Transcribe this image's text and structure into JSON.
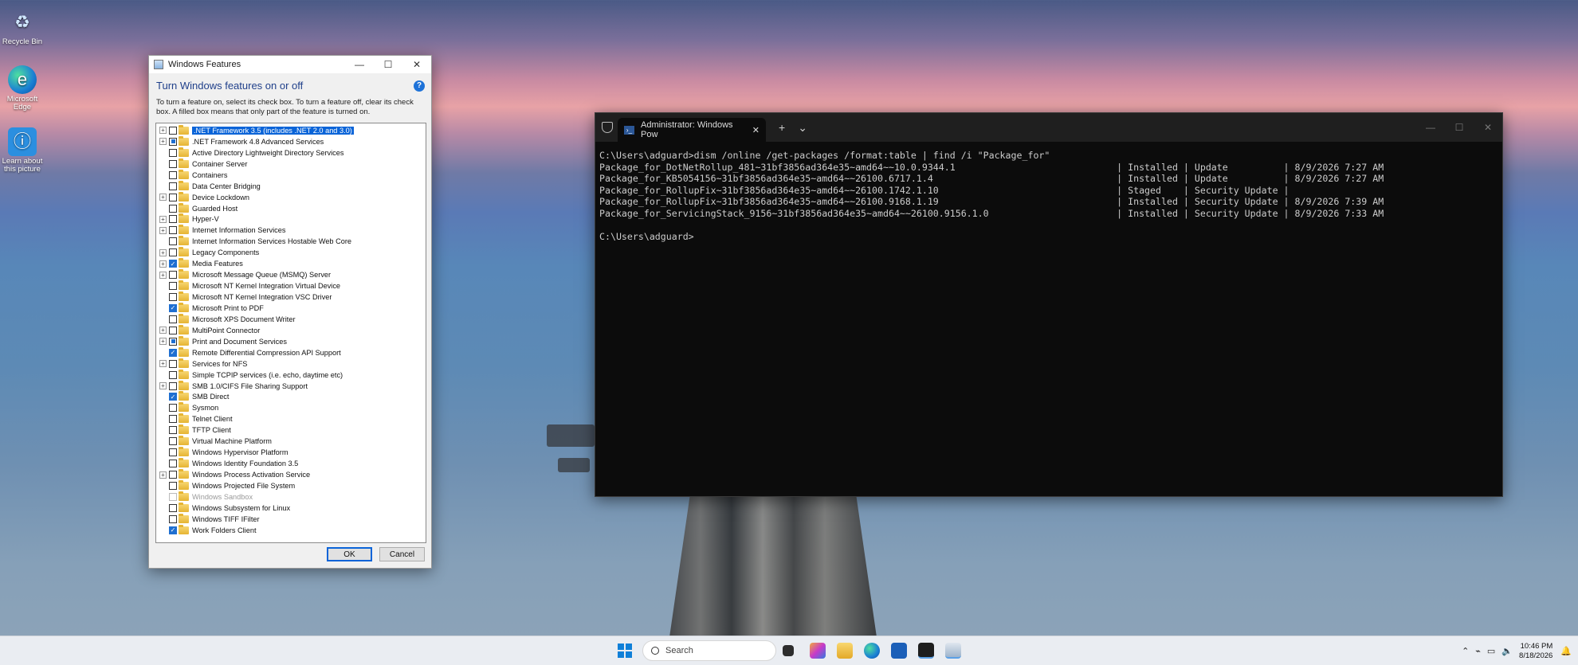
{
  "desktop": {
    "icons": [
      {
        "name": "recycle-bin",
        "label": "Recycle Bin",
        "glyph": "♻"
      },
      {
        "name": "microsoft-edge",
        "label": "Microsoft Edge",
        "glyph": "e"
      },
      {
        "name": "learn-about-picture",
        "label": "Learn about this picture",
        "glyph": "ⓘ"
      }
    ]
  },
  "features_dialog": {
    "title": "Windows Features",
    "heading": "Turn Windows features on or off",
    "help_glyph": "?",
    "description": "To turn a feature on, select its check box. To turn a feature off, clear its check box. A filled box means that only part of the feature is turned on.",
    "items": [
      {
        "label": ".NET Framework 3.5 (includes .NET 2.0 and 3.0)",
        "expand": true,
        "state": "off",
        "selected": true
      },
      {
        "label": ".NET Framework 4.8 Advanced Services",
        "expand": true,
        "state": "partial"
      },
      {
        "label": "Active Directory Lightweight Directory Services",
        "expand": false,
        "state": "off"
      },
      {
        "label": "Container Server",
        "expand": false,
        "state": "off"
      },
      {
        "label": "Containers",
        "expand": false,
        "state": "off"
      },
      {
        "label": "Data Center Bridging",
        "expand": false,
        "state": "off"
      },
      {
        "label": "Device Lockdown",
        "expand": true,
        "state": "off"
      },
      {
        "label": "Guarded Host",
        "expand": false,
        "state": "off"
      },
      {
        "label": "Hyper-V",
        "expand": true,
        "state": "off"
      },
      {
        "label": "Internet Information Services",
        "expand": true,
        "state": "off"
      },
      {
        "label": "Internet Information Services Hostable Web Core",
        "expand": false,
        "state": "off"
      },
      {
        "label": "Legacy Components",
        "expand": true,
        "state": "off"
      },
      {
        "label": "Media Features",
        "expand": true,
        "state": "checked"
      },
      {
        "label": "Microsoft Message Queue (MSMQ) Server",
        "expand": true,
        "state": "off"
      },
      {
        "label": "Microsoft NT Kernel Integration Virtual Device",
        "expand": false,
        "state": "off"
      },
      {
        "label": "Microsoft NT Kernel Integration VSC Driver",
        "expand": false,
        "state": "off"
      },
      {
        "label": "Microsoft Print to PDF",
        "expand": false,
        "state": "checked"
      },
      {
        "label": "Microsoft XPS Document Writer",
        "expand": false,
        "state": "off"
      },
      {
        "label": "MultiPoint Connector",
        "expand": true,
        "state": "off"
      },
      {
        "label": "Print and Document Services",
        "expand": true,
        "state": "partial"
      },
      {
        "label": "Remote Differential Compression API Support",
        "expand": false,
        "state": "checked"
      },
      {
        "label": "Services for NFS",
        "expand": true,
        "state": "off"
      },
      {
        "label": "Simple TCPIP services (i.e. echo, daytime etc)",
        "expand": false,
        "state": "off"
      },
      {
        "label": "SMB 1.0/CIFS File Sharing Support",
        "expand": true,
        "state": "off"
      },
      {
        "label": "SMB Direct",
        "expand": false,
        "state": "checked"
      },
      {
        "label": "Sysmon",
        "expand": false,
        "state": "off"
      },
      {
        "label": "Telnet Client",
        "expand": false,
        "state": "off"
      },
      {
        "label": "TFTP Client",
        "expand": false,
        "state": "off"
      },
      {
        "label": "Virtual Machine Platform",
        "expand": false,
        "state": "off"
      },
      {
        "label": "Windows Hypervisor Platform",
        "expand": false,
        "state": "off"
      },
      {
        "label": "Windows Identity Foundation 3.5",
        "expand": false,
        "state": "off"
      },
      {
        "label": "Windows Process Activation Service",
        "expand": true,
        "state": "off"
      },
      {
        "label": "Windows Projected File System",
        "expand": false,
        "state": "off"
      },
      {
        "label": "Windows Sandbox",
        "expand": false,
        "state": "disabled"
      },
      {
        "label": "Windows Subsystem for Linux",
        "expand": false,
        "state": "off"
      },
      {
        "label": "Windows TIFF IFilter",
        "expand": false,
        "state": "off"
      },
      {
        "label": "Work Folders Client",
        "expand": false,
        "state": "checked"
      }
    ],
    "ok_label": "OK",
    "cancel_label": "Cancel"
  },
  "terminal": {
    "tab_title": "Administrator: Windows Pow",
    "lines": [
      "C:\\Users\\adguard>dism /online /get-packages /format:table | find /i \"Package_for\"",
      "Package_for_DotNetRollup_481~31bf3856ad364e35~amd64~~10.0.9344.1                             | Installed | Update          | 8/9/2026 7:27 AM",
      "Package_for_KB5054156~31bf3856ad364e35~amd64~~26100.6717.1.4                                 | Installed | Update          | 8/9/2026 7:27 AM",
      "Package_for_RollupFix~31bf3856ad364e35~amd64~~26100.1742.1.10                                | Staged    | Security Update |",
      "Package_for_RollupFix~31bf3856ad364e35~amd64~~26100.9168.1.19                                | Installed | Security Update | 8/9/2026 7:39 AM",
      "Package_for_ServicingStack_9156~31bf3856ad364e35~amd64~~26100.9156.1.0                       | Installed | Security Update | 8/9/2026 7:33 AM",
      "",
      "C:\\Users\\adguard>"
    ]
  },
  "taskbar": {
    "search_placeholder": "Search",
    "time": "10:46 PM",
    "date": "8/18/2026",
    "colors": {
      "start": "#0f7fd8"
    }
  }
}
